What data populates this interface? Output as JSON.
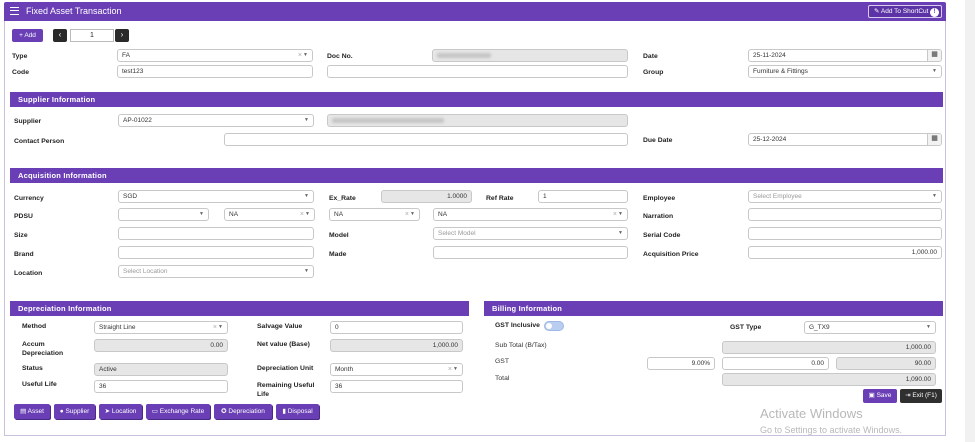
{
  "header": {
    "title": "Fixed Asset Transaction",
    "shortcut_label": "Add To ShortCut"
  },
  "toolbar": {
    "add_label": "+ Add",
    "prev_icon": "chevron-left",
    "next_icon": "chevron-right",
    "page_value": "1"
  },
  "top": {
    "type_label": "Type",
    "type_value": "FA",
    "docno_label": "Doc No.",
    "date_label": "Date",
    "date_value": "25-11-2024",
    "code_label": "Code",
    "code_value": "test123",
    "group_label": "Group",
    "group_value": "Furniture & Fittings"
  },
  "supplier": {
    "heading": "Supplier Information",
    "supplier_label": "Supplier",
    "supplier_value": "AP-01022",
    "contact_label": "Contact Person",
    "contact_value": "",
    "due_label": "Due Date",
    "due_value": "25-12-2024"
  },
  "acquisition": {
    "heading": "Acquisition Information",
    "currency_label": "Currency",
    "currency_value": "SGD",
    "exrate_label": "Ex_Rate",
    "exrate_value": "1.0000",
    "refrate_label": "Ref Rate",
    "refrate_value": "1",
    "employee_label": "Employee",
    "employee_placeholder": "Select Employee",
    "pdsu_label": "PDSU",
    "pdsu_value": "",
    "na1": "NA",
    "na2": "NA",
    "na3": "NA",
    "narration_label": "Narration",
    "narration_value": "",
    "size_label": "Size",
    "size_value": "",
    "model_label": "Model",
    "model_placeholder": "Select Model",
    "serial_label": "Serial Code",
    "serial_value": "",
    "brand_label": "Brand",
    "brand_value": "",
    "made_label": "Made",
    "made_value": "",
    "price_label": "Acquisition Price",
    "price_value": "1,000.00",
    "location_label": "Location",
    "location_placeholder": "Select Location"
  },
  "depreciation": {
    "heading": "Depreciation Information",
    "method_label": "Method",
    "method_value": "Straight Line",
    "salvage_label": "Salvage Value",
    "salvage_value": "0",
    "accum_label": "Accum Depreciation",
    "accum_value": "0.00",
    "netvalue_label": "Net value (Base)",
    "netvalue_value": "1,000.00",
    "status_label": "Status",
    "status_value": "Active",
    "unit_label": "Depreciation Unit",
    "unit_value": "Month",
    "life_label": "Useful Life",
    "life_value": "36",
    "remaining_label": "Remaining Useful Life",
    "remaining_value": "36"
  },
  "billing": {
    "heading": "Billing Information",
    "gst_inclusive_label": "GST Inclusive",
    "gst_inclusive_on": false,
    "gst_type_label": "GST Type",
    "gst_type_value": "G_TX9",
    "subtotal_label": "Sub Total (B/Tax)",
    "subtotal_value": "1,000.00",
    "gst_label": "GST",
    "gst_rate": "9.00%",
    "gst_amount": "0.00",
    "gst_value": "90.00",
    "total_label": "Total",
    "total_value": "1,090.00"
  },
  "footer": {
    "buttons": [
      "Asset",
      "Supplier",
      "Location",
      "Exchange Rate",
      "Depreciation",
      "Disposal"
    ],
    "save_label": "Save",
    "exit_label": "Exit (F1)"
  },
  "watermark": {
    "line1": "Activate Windows",
    "line2": "Go to Settings to activate Windows."
  },
  "colors": {
    "accent": "#6a3fb5",
    "dark_button": "#2f2f2f",
    "readonly_bg": "#e6e6e6"
  }
}
